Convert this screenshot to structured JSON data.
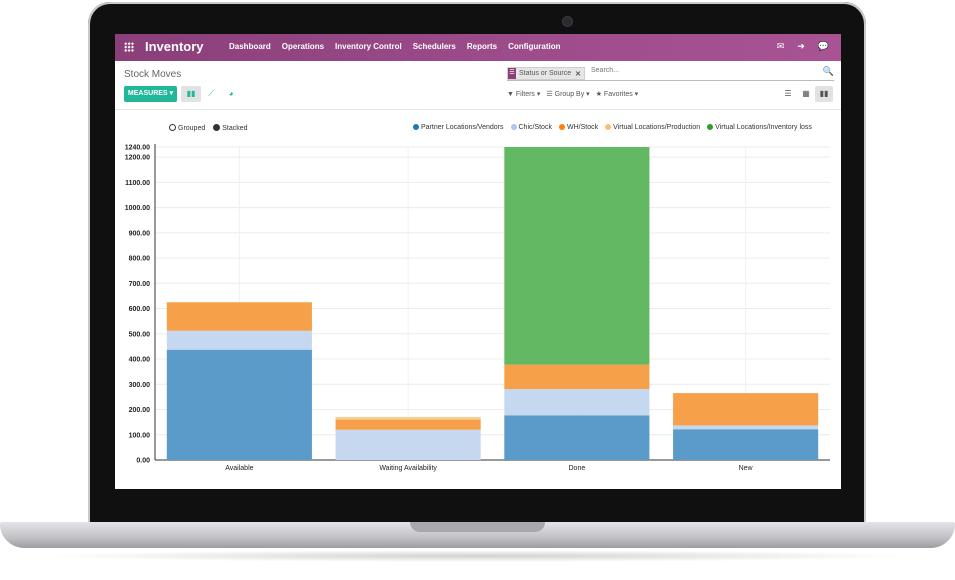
{
  "app": {
    "brand": "Inventory"
  },
  "menu": [
    "Dashboard",
    "Operations",
    "Inventory Control",
    "Schedulers",
    "Reports",
    "Configuration"
  ],
  "top_icons": [
    "mail-icon",
    "signout-icon",
    "chat-icon"
  ],
  "page_title": "Stock Moves",
  "search": {
    "facet_label": "Status or Source",
    "placeholder": "Search..."
  },
  "toolbar": {
    "measures_label": "MEASURES ▾",
    "filters_label": "Filters",
    "groupby_label": "Group By",
    "favorites_label": "Favorites"
  },
  "chart_modes": {
    "grouped": "Grouped",
    "stacked": "Stacked"
  },
  "colors": {
    "brand": "#8a3f79",
    "accent": "#21b799"
  },
  "chart_data": {
    "type": "bar",
    "stacked": true,
    "categories": [
      "Available",
      "Waiting Availability",
      "Done",
      "New"
    ],
    "series": [
      {
        "name": "Partner Locations/Vendors",
        "color": "#5a9bc9",
        "values": [
          437,
          0,
          177,
          122
        ]
      },
      {
        "name": "Chic/Stock",
        "color": "#c5d8f0",
        "values": [
          75,
          120,
          104,
          15
        ]
      },
      {
        "name": "WH/Stock",
        "color": "#f7a04a",
        "values": [
          113,
          40,
          97,
          128
        ]
      },
      {
        "name": "Virtual Locations/Production",
        "color": "#fbc98a",
        "values": [
          0,
          10,
          0,
          0
        ]
      },
      {
        "name": "Virtual Locations/Inventory loss",
        "color": "#63b963",
        "values": [
          0,
          0,
          862,
          0
        ]
      }
    ],
    "yticks": [
      "0.00",
      "100.00",
      "200.00",
      "300.00",
      "400.00",
      "500.00",
      "600.00",
      "700.00",
      "800.00",
      "900.00",
      "1000.00",
      "1100.00",
      "1200.00",
      "1240.00"
    ],
    "ylim": [
      0,
      1240
    ],
    "grid": true,
    "legend_position": "top-right"
  }
}
